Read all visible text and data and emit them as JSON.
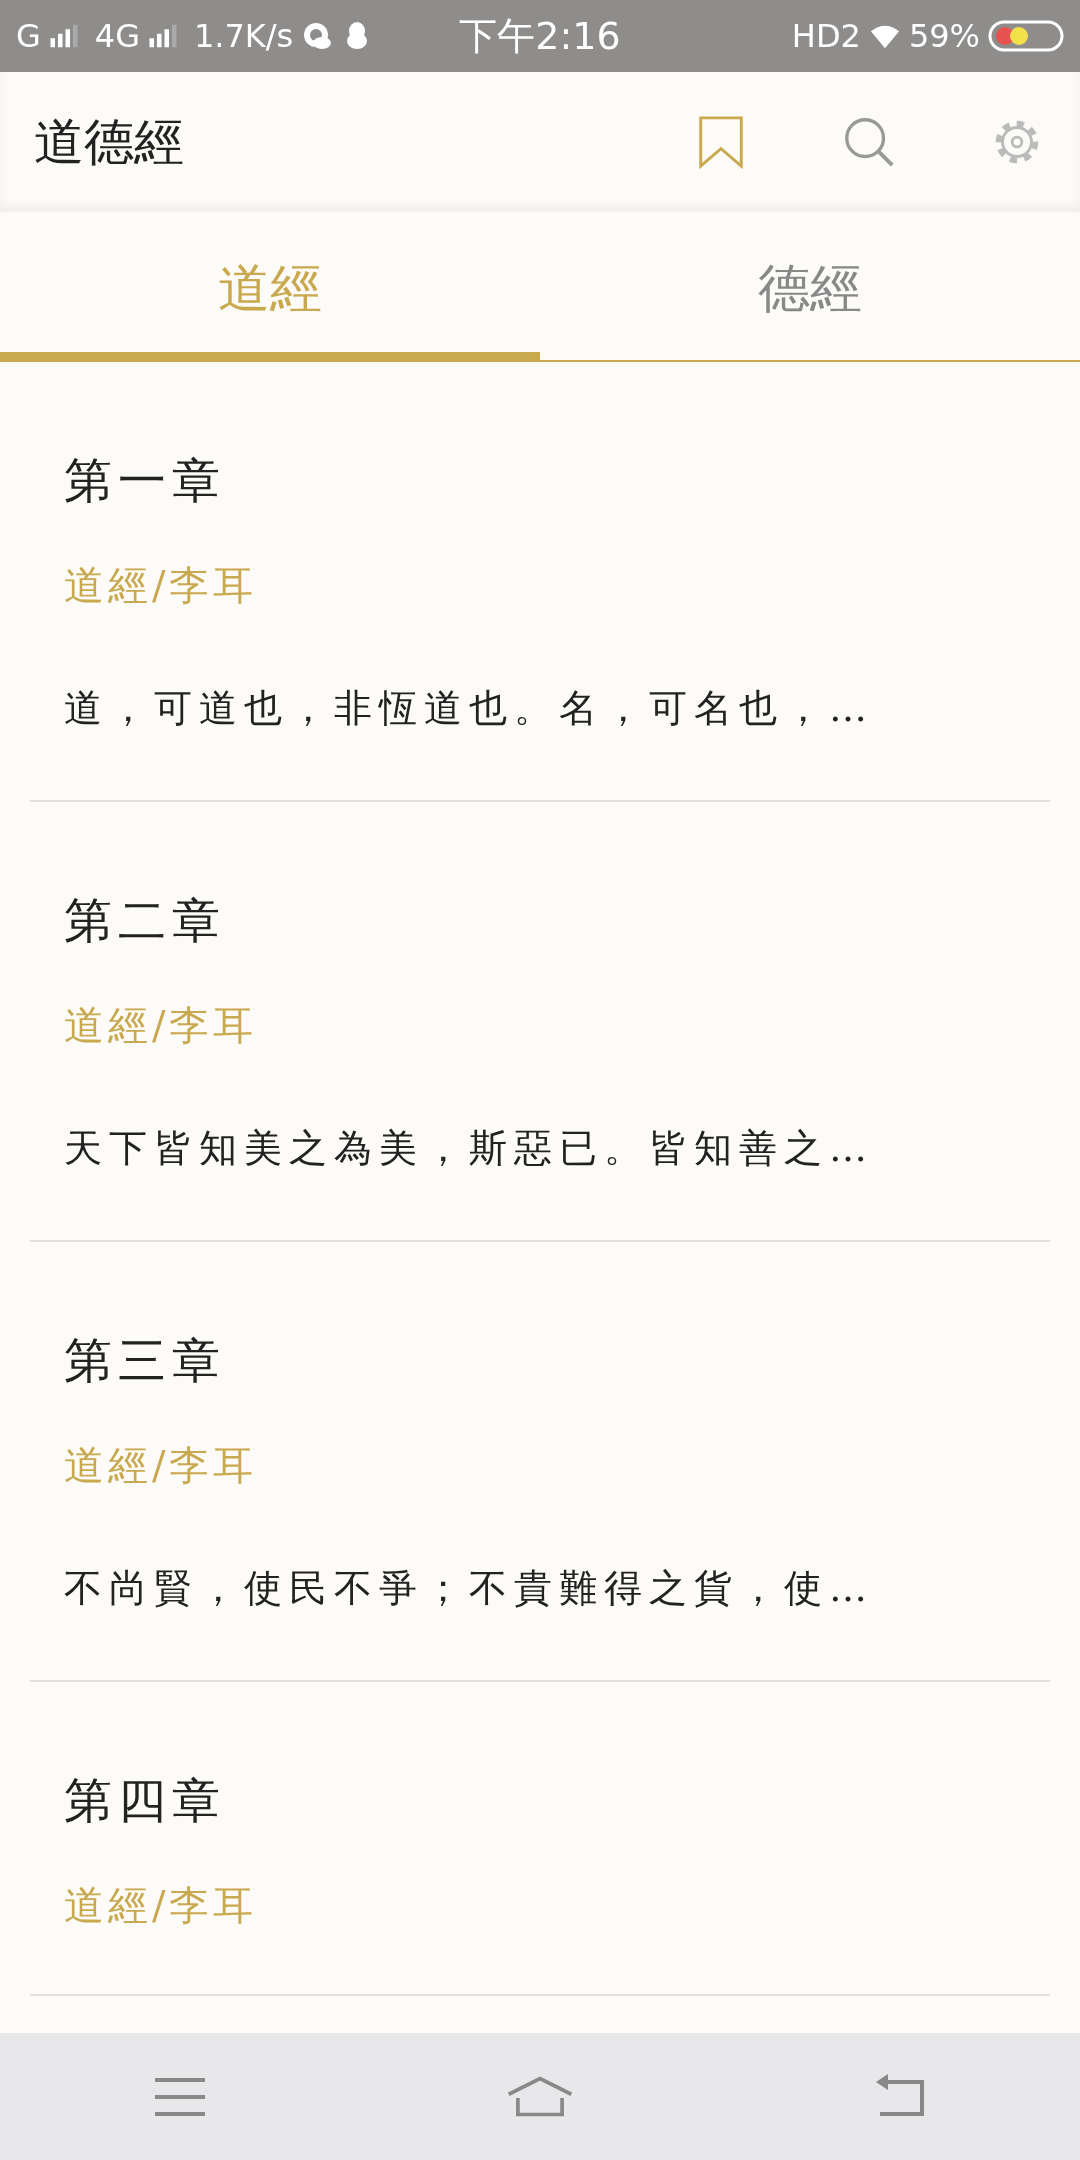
{
  "status_bar": {
    "carrier_1": "G",
    "carrier_2": "4G",
    "speed": "1.7K/s",
    "time": "下午2:16",
    "hd": "HD2",
    "battery": "59%"
  },
  "app_bar": {
    "title": "道德經"
  },
  "tabs": [
    {
      "label": "道經",
      "selected": true
    },
    {
      "label": "德經",
      "selected": false
    }
  ],
  "chapters": [
    {
      "title": "第一章",
      "author": "道經/李耳",
      "preview": "道，可道也，非恆道也。名，可名也，…"
    },
    {
      "title": "第二章",
      "author": "道經/李耳",
      "preview": "天下皆知美之為美，斯惡已。皆知善之…"
    },
    {
      "title": "第三章",
      "author": "道經/李耳",
      "preview": "不尚賢，使民不爭；不貴難得之貨，使…"
    },
    {
      "title": "第四章",
      "author": "道經/李耳"
    }
  ]
}
